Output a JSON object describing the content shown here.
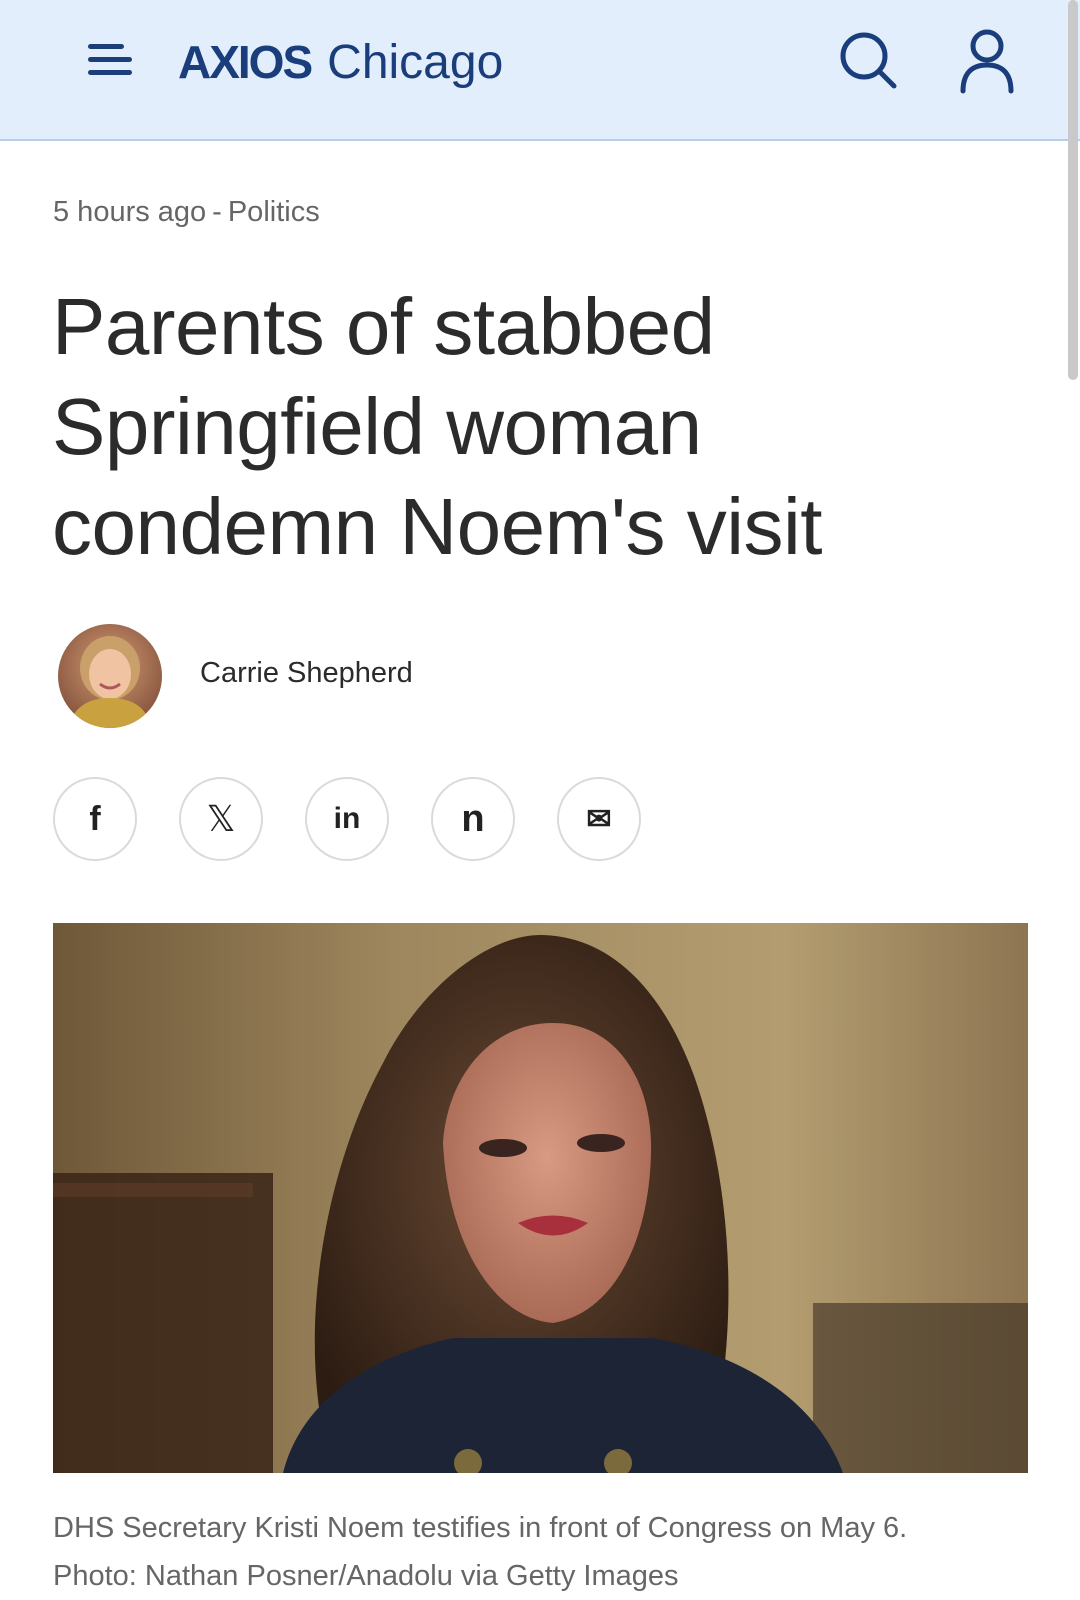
{
  "header": {
    "brand_logo": "AXIOS",
    "brand_city": "Chicago",
    "icons": {
      "menu": "menu-icon",
      "search": "search-icon",
      "account": "account-icon"
    },
    "colors": {
      "background": "#e3eefc",
      "brand": "#1a3d7c"
    }
  },
  "article": {
    "timestamp": "5 hours ago",
    "separator": "-",
    "topic": "Politics",
    "headline": "Parents of stabbed Springfield woman condemn Noem's visit",
    "author": {
      "name": "Carrie Shepherd"
    },
    "share": [
      {
        "network": "facebook",
        "glyph": "f",
        "icon": "facebook-icon"
      },
      {
        "network": "x",
        "glyph": "𝕏",
        "icon": "x-icon"
      },
      {
        "network": "linkedin",
        "glyph": "in",
        "icon": "linkedin-icon"
      },
      {
        "network": "newsletter",
        "glyph": "n",
        "icon": "newsletter-icon"
      },
      {
        "network": "email",
        "glyph": "✉",
        "icon": "email-icon"
      }
    ],
    "caption_line1": "DHS Secretary Kristi Noem testifies in front of Congress on May 6.",
    "caption_line2": "Photo: Nathan Posner/Anadolu via Getty Images"
  }
}
